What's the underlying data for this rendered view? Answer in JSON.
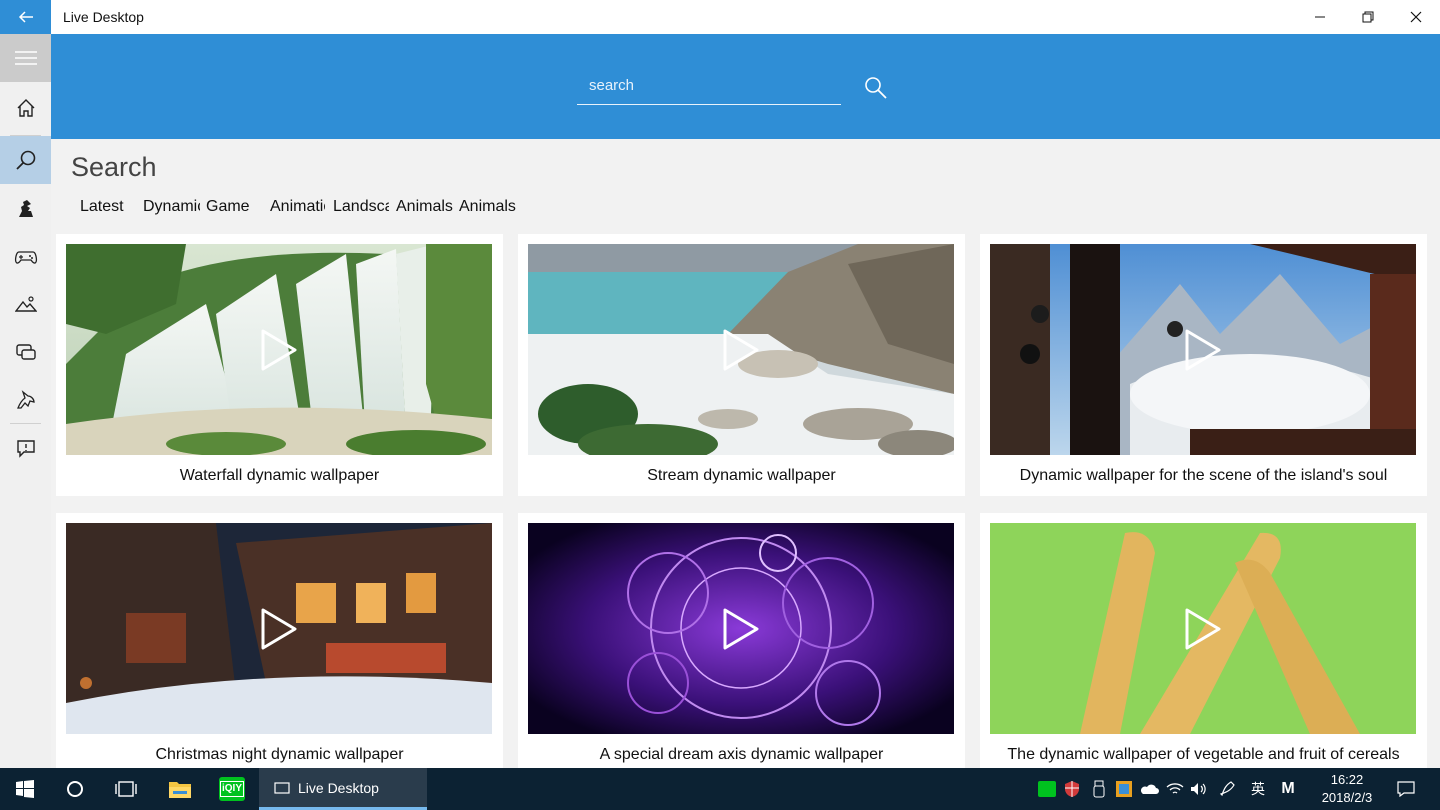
{
  "app": {
    "title": "Live Desktop"
  },
  "search": {
    "placeholder": "search"
  },
  "page": {
    "title": "Search"
  },
  "tabs": [
    {
      "label": "Latest"
    },
    {
      "label": "Dynamic"
    },
    {
      "label": "Game"
    },
    {
      "label": "Animation"
    },
    {
      "label": "Landscape"
    },
    {
      "label": "Animals"
    },
    {
      "label": "Animals"
    }
  ],
  "cards": [
    {
      "caption": "Waterfall dynamic wallpaper",
      "image": "waterfall"
    },
    {
      "caption": "Stream dynamic wallpaper",
      "image": "stream"
    },
    {
      "caption": "Dynamic wallpaper for the scene of the island's soul",
      "image": "bells-mountains"
    },
    {
      "caption": "Christmas night dynamic wallpaper",
      "image": "christmas-night"
    },
    {
      "caption": "A special dream axis dynamic wallpaper",
      "image": "dream-axis"
    },
    {
      "caption": "The dynamic wallpaper of vegetable and fruit of cereals",
      "image": "corn"
    }
  ],
  "nav": [
    {
      "icon": "hamburger-icon"
    },
    {
      "icon": "home-icon"
    },
    {
      "icon": "search-icon"
    },
    {
      "icon": "character-icon"
    },
    {
      "icon": "gamepad-icon"
    },
    {
      "icon": "landscape-icon"
    },
    {
      "icon": "animation-icon"
    },
    {
      "icon": "animal-icon"
    },
    {
      "icon": "feedback-icon"
    }
  ],
  "taskbar": {
    "app_label": "Live Desktop",
    "clock_time": "16:22",
    "clock_date": "2018/2/3",
    "ime_label": "英",
    "m_label": "M",
    "iqiyi_label": "iQIY"
  },
  "colors": {
    "accent": "#2f8ed6",
    "taskbar": "#0c2233",
    "active_nav": "#b5cfe6"
  }
}
